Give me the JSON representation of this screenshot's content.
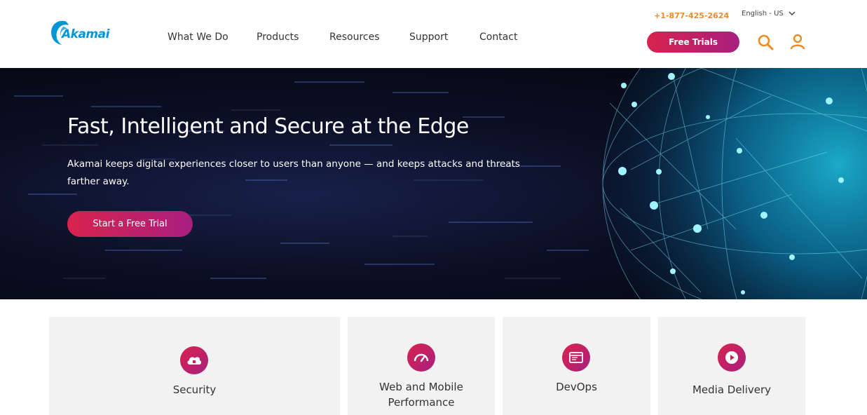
{
  "brand": {
    "logo_text": "Akamai",
    "accent_color": "#0096d6"
  },
  "header": {
    "phone": "+1-877-425-2624",
    "language": "English - US",
    "free_trials_label": "Free Trials",
    "nav": [
      "What We Do",
      "Products",
      "Resources",
      "Support",
      "Contact"
    ]
  },
  "hero": {
    "title": "Fast, Intelligent and Secure at the Edge",
    "subtitle": "Akamai keeps digital experiences closer to users than anyone — and keeps attacks and threats farther away.",
    "cta_label": "Start a Free Trial"
  },
  "cards": [
    {
      "label": "Security",
      "icon": "cloud-lock-icon"
    },
    {
      "label": "Web and Mobile Performance",
      "icon": "speedometer-icon"
    },
    {
      "label": "DevOps",
      "icon": "terminal-window-icon"
    },
    {
      "label": "Media Delivery",
      "icon": "play-icon"
    }
  ],
  "colors": {
    "cta_gradient_start": "#d8234d",
    "cta_gradient_end": "#a81f7f",
    "phone": "#f08a24",
    "icon_orange": "#f08a24"
  }
}
